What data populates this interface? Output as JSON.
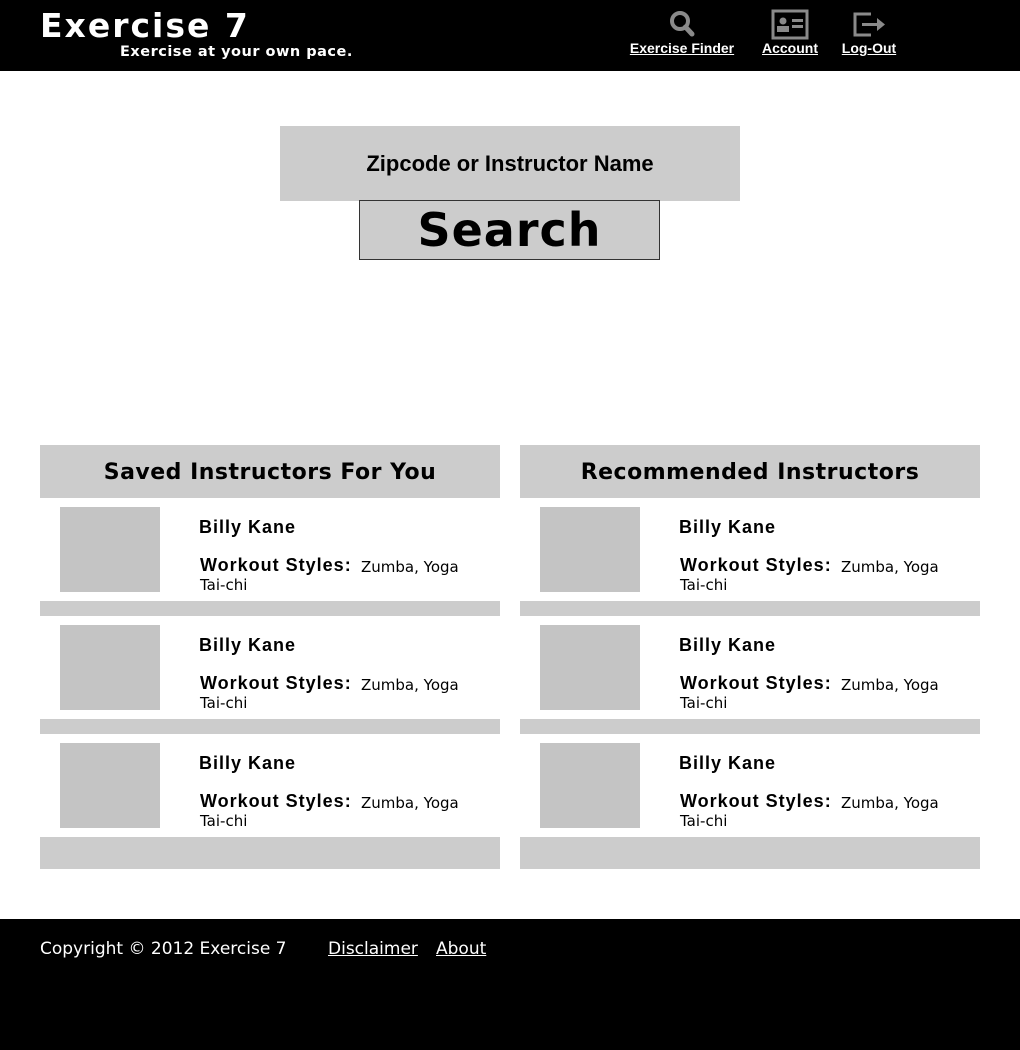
{
  "header": {
    "title": "Exercise 7",
    "tagline": "Exercise at your own pace.",
    "nav": {
      "finder_label": "Exercise Finder",
      "account_label": "Account",
      "logout_label": "Log-Out"
    }
  },
  "search": {
    "placeholder": "Zipcode or Instructor Name",
    "button_label": "Search"
  },
  "saved": {
    "title": "Saved Instructors For You",
    "items": [
      {
        "name": "Billy Kane",
        "styles_label": "Workout Styles:",
        "styles": "Zumba, Yoga",
        "styles_more": "Tai-chi"
      },
      {
        "name": "Billy Kane",
        "styles_label": "Workout Styles:",
        "styles": "Zumba, Yoga",
        "styles_more": "Tai-chi"
      },
      {
        "name": "Billy Kane",
        "styles_label": "Workout Styles:",
        "styles": "Zumba, Yoga",
        "styles_more": "Tai-chi"
      }
    ]
  },
  "recommended": {
    "title": "Recommended Instructors",
    "items": [
      {
        "name": "Billy Kane",
        "styles_label": "Workout Styles:",
        "styles": "Zumba, Yoga",
        "styles_more": "Tai-chi"
      },
      {
        "name": "Billy Kane",
        "styles_label": "Workout Styles:",
        "styles": "Zumba, Yoga",
        "styles_more": "Tai-chi"
      },
      {
        "name": "Billy Kane",
        "styles_label": "Workout Styles:",
        "styles": "Zumba, Yoga",
        "styles_more": "Tai-chi"
      }
    ]
  },
  "footer": {
    "copyright": "Copyright © 2012 Exercise 7",
    "disclaimer_label": "Disclaimer",
    "about_label": "About"
  },
  "icons": {
    "finder": "search-icon",
    "account": "account-card-icon",
    "logout": "logout-icon"
  },
  "colors": {
    "header_bg": "#000000",
    "panel_gray": "#cccccc",
    "photo_gray": "#c4c4c4",
    "text_light": "#ffffff"
  }
}
